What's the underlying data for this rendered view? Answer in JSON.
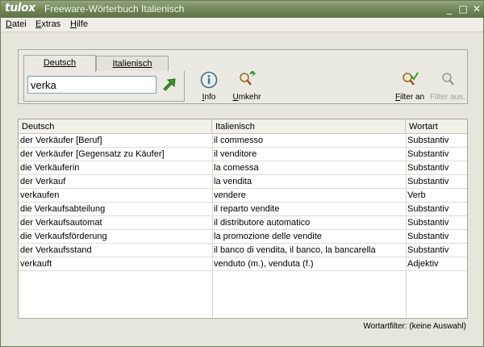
{
  "window": {
    "logo": "tulox",
    "title": "Freeware-Wörterbuch Italienisch",
    "controls": {
      "minimize": "_",
      "maximize": "□",
      "close": "✕"
    }
  },
  "menubar": {
    "items": [
      {
        "first": "D",
        "rest": "atei"
      },
      {
        "first": "E",
        "rest": "xtras"
      },
      {
        "first": "H",
        "rest": "ilfe"
      }
    ]
  },
  "tabs": [
    {
      "label": "Deutsch",
      "active": true
    },
    {
      "label": "Italienisch",
      "active": false
    }
  ],
  "search": {
    "value": "verka"
  },
  "toolbar": {
    "info": {
      "first": "",
      "u": "I",
      "rest": "nfo"
    },
    "umkehr": {
      "first": "",
      "u": "U",
      "rest": "mkehr"
    },
    "filter_an": {
      "first": "",
      "u": "F",
      "rest": "ilter an"
    },
    "filter_aus": {
      "label": "Filter aus."
    }
  },
  "table": {
    "headers": [
      "Deutsch",
      "Italienisch",
      "Wortart"
    ],
    "rows": [
      [
        "der Verkäufer [Beruf]",
        "il commesso",
        "Substantiv"
      ],
      [
        "der Verkäufer [Gegensatz zu Käufer]",
        "il venditore",
        "Substantiv"
      ],
      [
        "die Verkäuferin",
        "la comessa",
        "Substantiv"
      ],
      [
        "der Verkauf",
        "la vendita",
        "Substantiv"
      ],
      [
        "verkaufen",
        "vendere",
        "Verb"
      ],
      [
        "die Verkaufsabteilung",
        "il reparto vendite",
        "Substantiv"
      ],
      [
        "der Verkaufsautomat",
        "il distributore automatico",
        "Substantiv"
      ],
      [
        "die Verkaufsförderung",
        "la promozione delle vendite",
        "Substantiv"
      ],
      [
        "der Verkaufsstand",
        "il banco di vendita, il banco, la bancarella",
        "Substantiv"
      ],
      [
        "verkauft",
        "venduto (m.), venduta (f.)",
        "Adjektiv"
      ]
    ]
  },
  "status": {
    "text": "Wortartfilter: (keine Auswahl)"
  },
  "colors": {
    "titlebar": "#6f8457",
    "accent_green": "#3a9a2a",
    "info_blue": "#3f6f86"
  }
}
